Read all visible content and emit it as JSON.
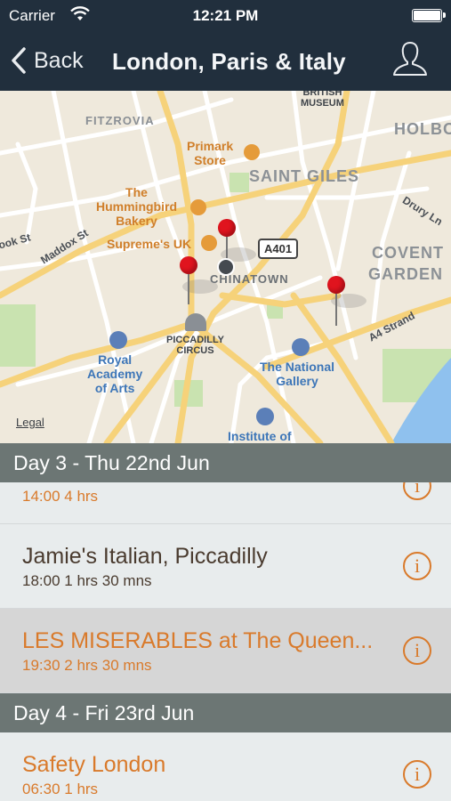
{
  "status_bar": {
    "carrier": "Carrier",
    "time": "12:21 PM"
  },
  "nav": {
    "back_label": "Back",
    "title": "London, Paris & Italy"
  },
  "map": {
    "areas": [
      "FITZROVIA",
      "SAINT GILES",
      "COVENT",
      "GARDEN",
      "CHINATOWN",
      "HOLBO"
    ],
    "pois": {
      "british_museum": [
        "BRITISH",
        "MUSEUM"
      ],
      "primark": [
        "Primark",
        "Store"
      ],
      "hummingbird": [
        "The",
        "Hummingbird",
        "Bakery"
      ],
      "supreme": "Supreme's UK",
      "piccadilly": [
        "PICCADILLY",
        "CIRCUS"
      ],
      "royal_academy": [
        "Royal",
        "Academy",
        "of Arts"
      ],
      "national_gallery": [
        "The National",
        "Gallery"
      ],
      "institute": "Institute of"
    },
    "streets": {
      "maddox": "Maddox St",
      "brook": "ook St",
      "drury": "Drury Ln",
      "strand": "A4  Strand"
    },
    "road_shield": "A401",
    "legal": "Legal"
  },
  "itinerary": {
    "day3": {
      "header": "Day 3 - Thu 22nd Jun",
      "events": [
        {
          "name": "",
          "time": "14:00 4 hrs"
        },
        {
          "name": "Jamie's Italian, Piccadilly",
          "time": "18:00 1 hrs 30 mns"
        },
        {
          "name": "LES MISERABLES at The Queen...",
          "time": "19:30 2 hrs 30 mns"
        }
      ]
    },
    "day4": {
      "header": "Day 4 - Fri 23rd Jun",
      "events": [
        {
          "name": "Safety London",
          "time": "06:30 1 hrs"
        }
      ]
    },
    "info_glyph": "i"
  },
  "colors": {
    "nav_bg": "#212f3d",
    "accent": "#d97a2b",
    "section_bg": "#6c7674",
    "selected_row": "#d6d6d6",
    "pin": "#e0141e"
  }
}
